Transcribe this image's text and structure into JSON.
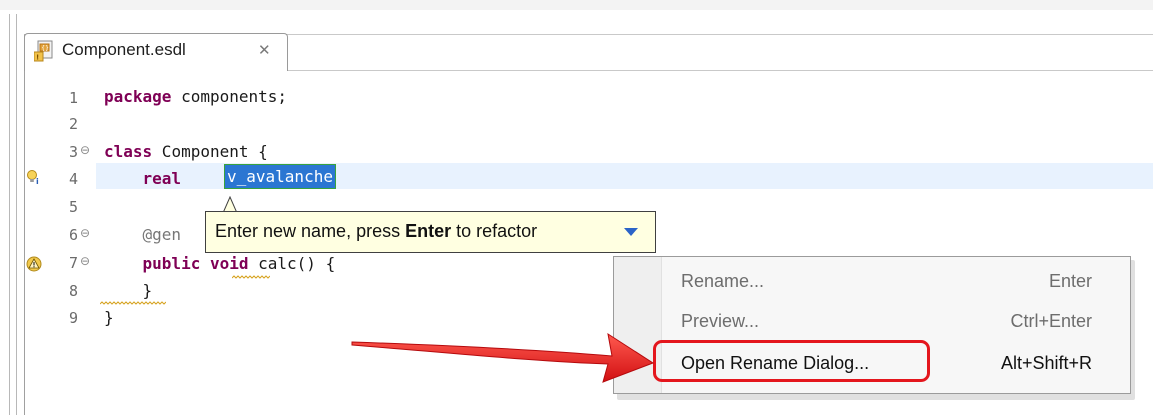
{
  "editor": {
    "tab": {
      "filename": "Component.esdl",
      "close_glyph": "✕"
    },
    "line_numbers": [
      "1",
      "2",
      "3",
      "4",
      "5",
      "6",
      "7",
      "8",
      "9"
    ],
    "lines": {
      "l1_kw": "package",
      "l1_rest": " components;",
      "l3_kw": "class",
      "l3_rest": " Component {",
      "l4_indent": "    ",
      "l4_kw": "real",
      "l4_var": "v_avalanche",
      "l4_end": ";",
      "l6": "    @gen",
      "l7_indent": "    ",
      "l7_kw1": "public",
      "l7_kw2": "void",
      "l7_rest": " calc() {",
      "l8": "    }",
      "l9": "}"
    }
  },
  "tooltip": {
    "prefix": "Enter new name, press ",
    "key": "Enter",
    "suffix": " to refactor"
  },
  "context_menu": {
    "items": [
      {
        "label": "Rename...",
        "shortcut": "Enter",
        "enabled": false
      },
      {
        "label": "Preview...",
        "shortcut": "Ctrl+Enter",
        "enabled": false
      },
      {
        "label": "Open Rename Dialog...",
        "shortcut": "Alt+Shift+R",
        "enabled": true,
        "highlighted": true
      }
    ]
  },
  "icons": {
    "file": "esdl-file-icon",
    "info_marker": "info-marker-icon",
    "warning_marker": "warning-marker-icon",
    "dropdown": "chevron-down-icon",
    "annotation_arrow": "red-arrow-icon"
  },
  "colors": {
    "keyword": "#7f0055",
    "selection": "#2b76d2",
    "tooltip_bg": "#ffffe1",
    "highlight_border": "#e4161d",
    "current_line": "#e8f2fe"
  }
}
